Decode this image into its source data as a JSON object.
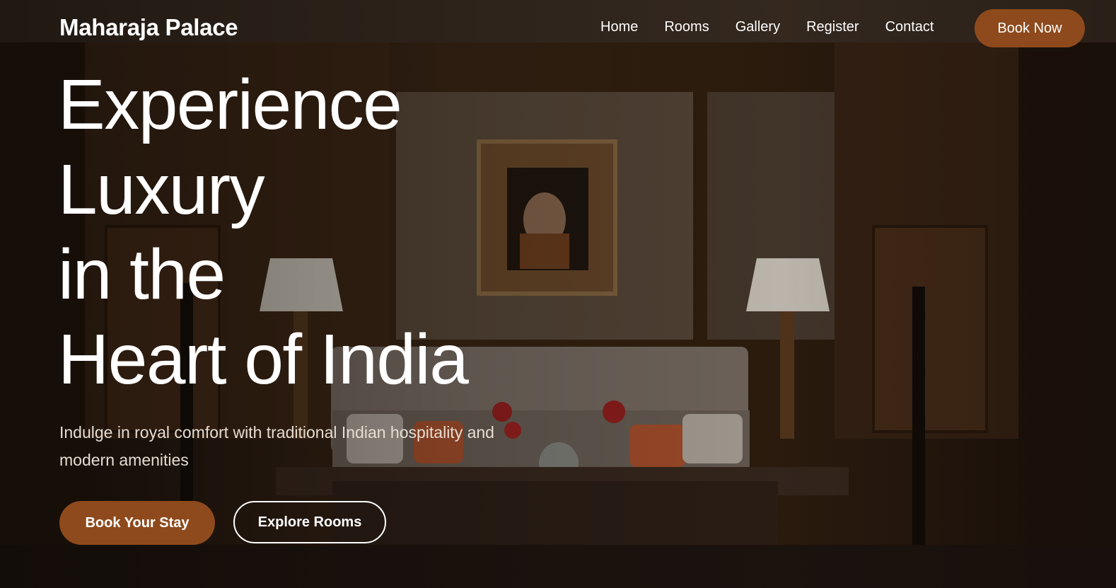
{
  "brand": {
    "name": "Maharaja Palace"
  },
  "nav": {
    "links": [
      {
        "label": "Home"
      },
      {
        "label": "Rooms"
      },
      {
        "label": "Gallery"
      },
      {
        "label": "Register"
      },
      {
        "label": "Contact"
      }
    ],
    "cta_label": "Book Now"
  },
  "hero": {
    "headline_lines": [
      "Experience",
      "Luxury",
      "in the",
      "Heart of India"
    ],
    "subtitle": "Indulge in royal comfort with traditional Indian hospitality and modern amenities",
    "primary_cta": "Book Your Stay",
    "secondary_cta": "Explore Rooms"
  },
  "colors": {
    "accent": "#8e4a1d",
    "text": "#ffffff"
  }
}
